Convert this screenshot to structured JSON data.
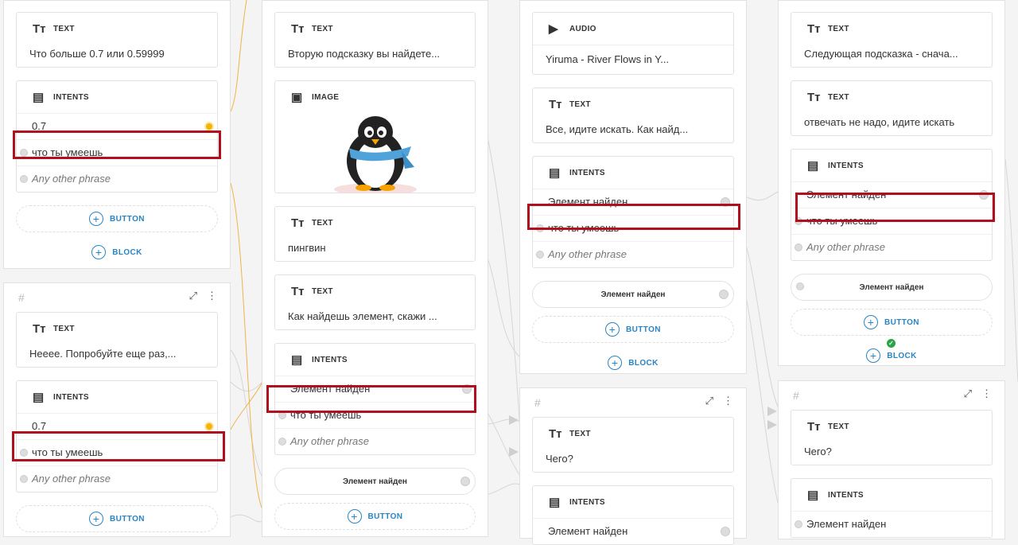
{
  "labels": {
    "text": "TEXT",
    "intents": "INTENTS",
    "image": "IMAGE",
    "audio": "AUDIO",
    "button": "BUTTON",
    "block": "BLOCK",
    "hash": "#"
  },
  "col1": {
    "text1": "Что больше 0.7 или 0.59999",
    "intents1": [
      "0.7",
      "что ты умеешь",
      "Any other phrase"
    ],
    "text2": "Нееее. Попробуйте еще раз,...",
    "intents2": [
      "0.7",
      "что ты умеешь",
      "Any other phrase"
    ]
  },
  "col2": {
    "text1": "Вторую подсказку вы найдете...",
    "text2": "пингвин",
    "text3": "Как найдешь элемент, скажи ...",
    "intents": [
      "Элемент найден",
      "что ты умеешь",
      "Any other phrase"
    ],
    "button1": "Элемент найден"
  },
  "col3": {
    "audio": "Yiruma - River Flows in Y...",
    "text1": "Все, идите искать. Как найд...",
    "intents": [
      "Элемент найден",
      "что ты умеешь",
      "Any other phrase"
    ],
    "button1": "Элемент найден",
    "text2": "Чего?",
    "intents2": [
      "Элемент найден"
    ]
  },
  "col4": {
    "text1": "Следующая подсказка - снача...",
    "text2": "отвечать не надо, идите искать",
    "intents": [
      "Элемент найден",
      "что ты умеешь",
      "Any other phrase"
    ],
    "button1": "Элемент найден",
    "text3": "Чего?",
    "intents2": [
      "Элемент найден"
    ]
  },
  "colors": {
    "accent": "#2a84c4",
    "highlight": "#b0101e",
    "orange": "#f4b400",
    "green": "#2aa44a"
  }
}
